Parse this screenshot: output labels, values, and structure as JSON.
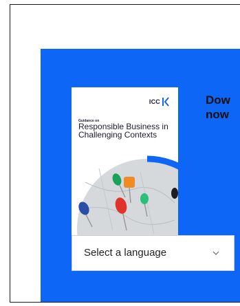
{
  "promo": {
    "headline": "Dow\nnow",
    "colors": {
      "background": "#0d66f5",
      "cover_arc": "#0d66f5"
    }
  },
  "publication": {
    "brand": "ICC",
    "kicker": "Guidance on",
    "title": "Responsible Business in Challenging Contexts"
  },
  "language_select": {
    "label": "Select a language",
    "icon": "chevron-down-icon"
  }
}
